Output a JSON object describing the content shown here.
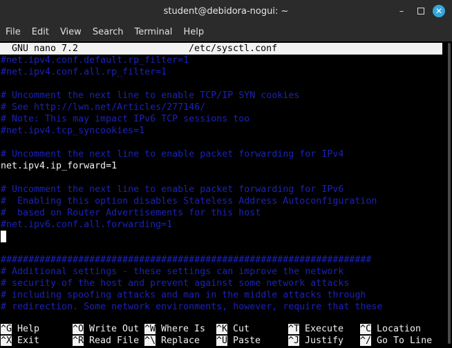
{
  "window": {
    "title": "student@debidora-nogui: ~",
    "minimize_glyph": "–",
    "close_glyph": "✕"
  },
  "menu": [
    "File",
    "Edit",
    "View",
    "Search",
    "Terminal",
    "Help"
  ],
  "nano": {
    "version": "GNU nano 7.2",
    "filename": "/etc/sysctl.conf"
  },
  "lines": [
    {
      "text": "#net.ipv4.conf.default.rp_filter=1",
      "kind": "comment"
    },
    {
      "text": "#net.ipv4.conf.all.rp_filter=1",
      "kind": "comment"
    },
    {
      "text": "",
      "kind": "blank"
    },
    {
      "text": "# Uncomment the next line to enable TCP/IP SYN cookies",
      "kind": "comment"
    },
    {
      "text": "# See http://lwn.net/Articles/277146/",
      "kind": "comment"
    },
    {
      "text": "# Note: This may impact IPv6 TCP sessions too",
      "kind": "comment"
    },
    {
      "text": "#net.ipv4.tcp_syncookies=1",
      "kind": "comment"
    },
    {
      "text": "",
      "kind": "blank"
    },
    {
      "text": "# Uncomment the next line to enable packet forwarding for IPv4",
      "kind": "comment"
    },
    {
      "text": "net.ipv4.ip_forward=1",
      "kind": "code"
    },
    {
      "text": "",
      "kind": "blank"
    },
    {
      "text": "# Uncomment the next line to enable packet forwarding for IPv6",
      "kind": "comment"
    },
    {
      "text": "#  Enabling this option disables Stateless Address Autoconfiguration",
      "kind": "comment"
    },
    {
      "text": "#  based on Router Advertisements for this host",
      "kind": "comment"
    },
    {
      "text": "#net.ipv6.conf.all.forwarding=1",
      "kind": "comment"
    },
    {
      "text": "",
      "kind": "cursor"
    },
    {
      "text": "",
      "kind": "blank"
    },
    {
      "text": "###################################################################",
      "kind": "comment"
    },
    {
      "text": "# Additional settings - these settings can improve the network",
      "kind": "comment"
    },
    {
      "text": "# security of the host and prevent against some network attacks",
      "kind": "comment"
    },
    {
      "text": "# including spoofing attacks and man in the middle attacks through",
      "kind": "comment"
    },
    {
      "text": "# redirection. Some network environments, however, require that these",
      "kind": "comment"
    }
  ],
  "shortcuts": [
    {
      "key": "^G",
      "label": "Help"
    },
    {
      "key": "^O",
      "label": "Write Out"
    },
    {
      "key": "^W",
      "label": "Where Is"
    },
    {
      "key": "^K",
      "label": "Cut"
    },
    {
      "key": "^T",
      "label": "Execute"
    },
    {
      "key": "^C",
      "label": "Location"
    },
    {
      "key": "^X",
      "label": "Exit"
    },
    {
      "key": "^R",
      "label": "Read File"
    },
    {
      "key": "^\\",
      "label": "Replace"
    },
    {
      "key": "^U",
      "label": "Paste"
    },
    {
      "key": "^J",
      "label": "Justify"
    },
    {
      "key": "^/",
      "label": "Go To Line"
    }
  ],
  "colors": {
    "comment": "#1b22b8",
    "text": "#f0f0f0",
    "background": "#000000",
    "titlebar": "#2b2b2b",
    "close_button": "#35a7de"
  }
}
